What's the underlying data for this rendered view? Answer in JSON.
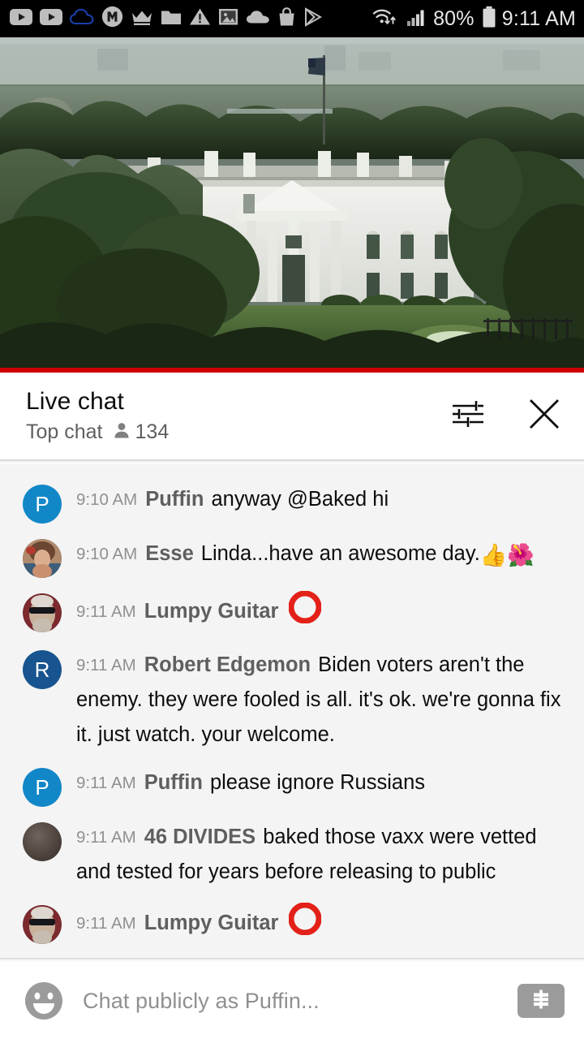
{
  "status_bar": {
    "icons": [
      {
        "name": "youtube-icon"
      },
      {
        "name": "youtube-icon"
      },
      {
        "name": "cloud-outline-icon"
      },
      {
        "name": "m-badge-icon"
      },
      {
        "name": "crown-icon"
      },
      {
        "name": "folder-icon"
      },
      {
        "name": "warning-triangle-icon"
      },
      {
        "name": "image-icon"
      },
      {
        "name": "cloud-filled-icon"
      },
      {
        "name": "shopping-bag-icon"
      },
      {
        "name": "play-store-icon"
      }
    ],
    "wifi_icon": "wifi-data-icon",
    "signal_icon": "cellular-signal-icon",
    "battery_percent": "80%",
    "battery_icon": "battery-icon",
    "clock": "9:11 AM"
  },
  "video": {
    "name": "white-house-live-stream",
    "progress_color": "#cc0000"
  },
  "chat_header": {
    "title": "Live chat",
    "subtitle": "Top chat",
    "viewer_icon": "person-icon",
    "viewer_count": "134",
    "settings_icon": "tune-sliders-icon",
    "close_icon": "close-icon"
  },
  "messages": [
    {
      "avatar_type": "initial",
      "avatar_letter": "P",
      "avatar_color": "#1287c8",
      "timestamp": "9:10 AM",
      "author": "Puffin",
      "text": "anyway @Baked hi",
      "emoji": ""
    },
    {
      "avatar_type": "photo-woman",
      "avatar_letter": "",
      "avatar_color": "#b98a72",
      "timestamp": "9:10 AM",
      "author": "Esse",
      "text": "Linda...have an awesome day.",
      "emoji": "👍🌺"
    },
    {
      "avatar_type": "photo-man",
      "avatar_letter": "",
      "avatar_color": "#7d2a2f",
      "timestamp": "9:11 AM",
      "author": "Lumpy Guitar",
      "text": "",
      "emoji": "red-circle"
    },
    {
      "avatar_type": "initial",
      "avatar_letter": "R",
      "avatar_color": "#18548f",
      "timestamp": "9:11 AM",
      "author": "Robert Edgemon",
      "text": "Biden voters aren't the enemy. they were fooled is all. it's ok. we're gonna fix it. just watch. your welcome.",
      "emoji": ""
    },
    {
      "avatar_type": "initial",
      "avatar_letter": "P",
      "avatar_color": "#1287c8",
      "timestamp": "9:11 AM",
      "author": "Puffin",
      "text": "please ignore Russians",
      "emoji": ""
    },
    {
      "avatar_type": "photo-dark",
      "avatar_letter": "",
      "avatar_color": "#5a4f49",
      "timestamp": "9:11 AM",
      "author": "46 DIVIDES",
      "text": "baked those vaxx were vetted and tested for years before releasing to public",
      "emoji": ""
    },
    {
      "avatar_type": "photo-man",
      "avatar_letter": "",
      "avatar_color": "#7d2a2f",
      "timestamp": "9:11 AM",
      "author": "Lumpy Guitar",
      "text": "",
      "emoji": "red-circle"
    }
  ],
  "input_bar": {
    "emoji_icon": "emoji-smiley-icon",
    "placeholder": "Chat publicly as Puffin...",
    "superchat_icon": "dollar-superchat-icon"
  }
}
